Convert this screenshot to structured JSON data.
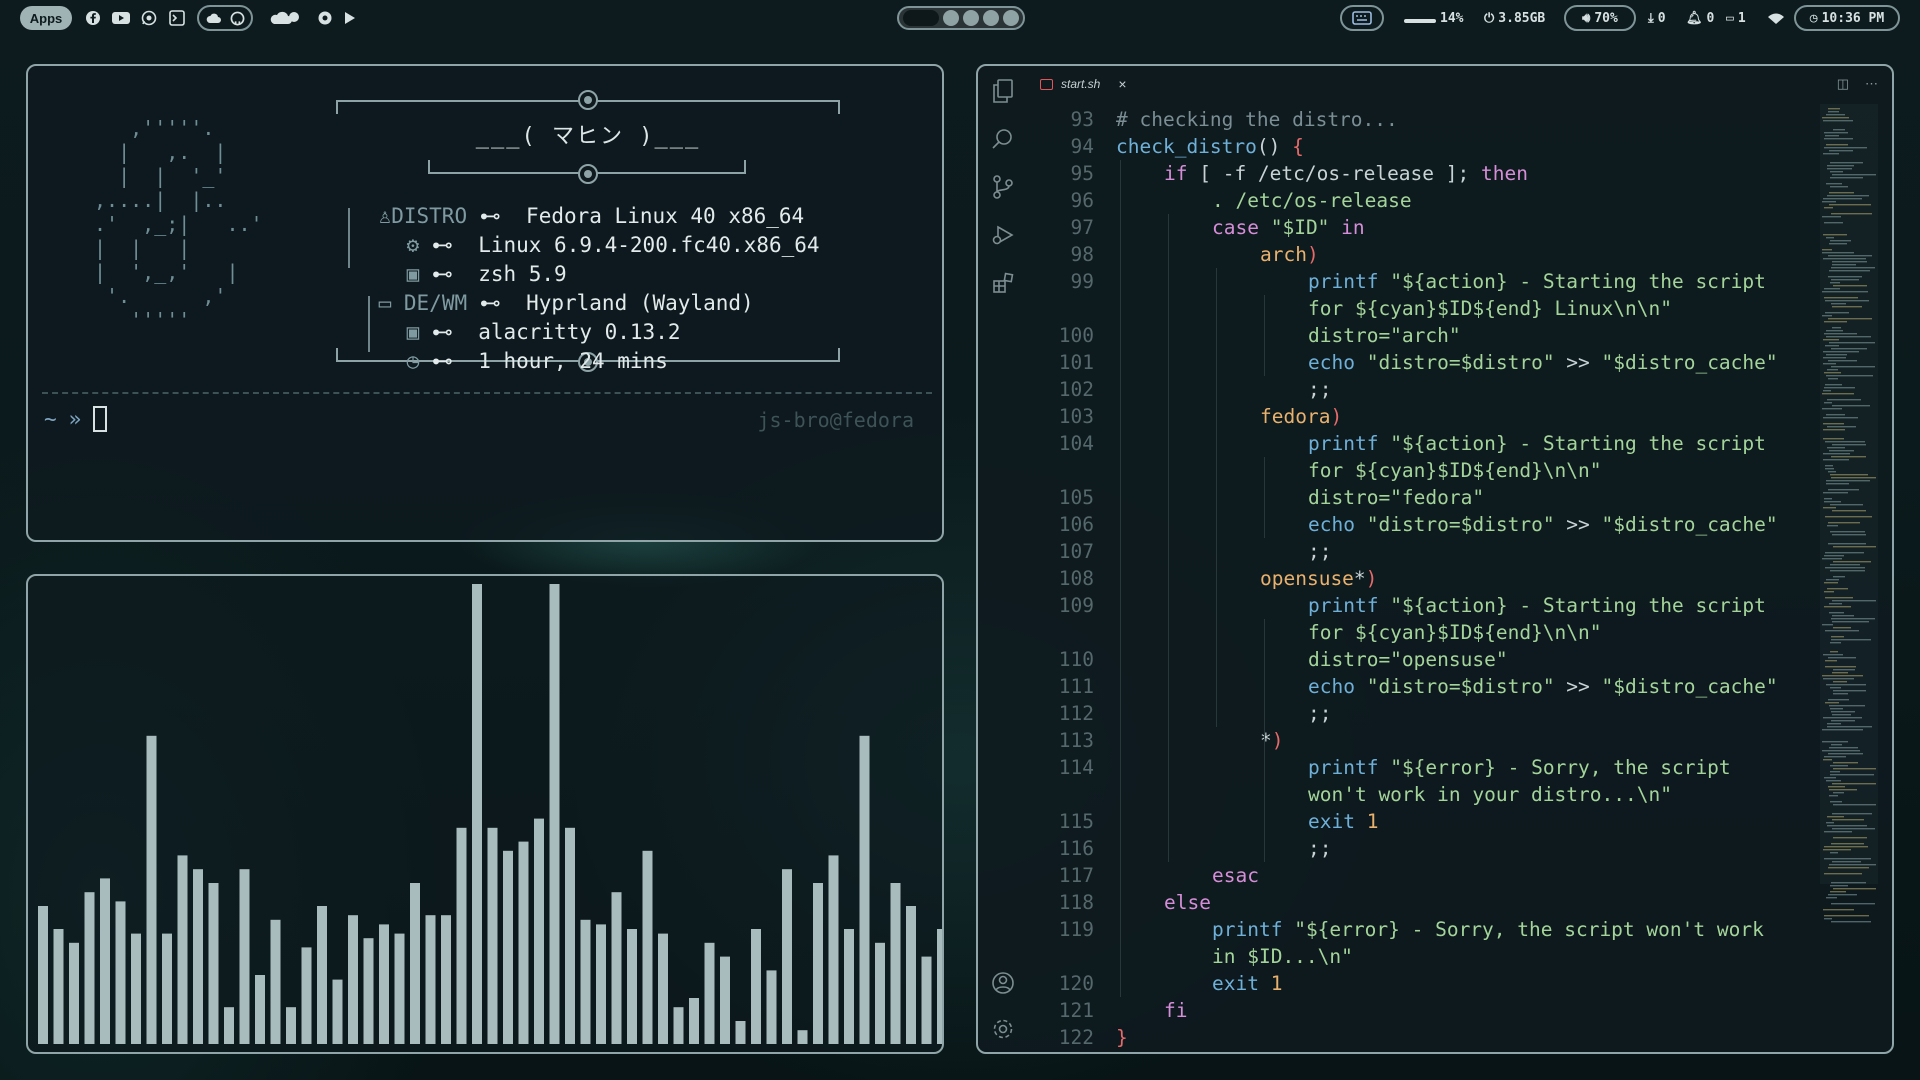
{
  "topbar": {
    "apps_label": "Apps",
    "left_icons": [
      "facebook-icon",
      "youtube-icon",
      "whatsapp-icon",
      "terminal-app-icon",
      "cloud-icon",
      "github-icon",
      "weather-icon",
      "browser-icon",
      "play-icon"
    ],
    "stats": {
      "keyboard": "",
      "cpu": "14%",
      "memory": "3.85GB",
      "volume": "70%",
      "downloads": "0",
      "notifications": "0",
      "clipboard": "1",
      "time": "10:36 PM"
    }
  },
  "terminal": {
    "ascii_art": "   ,'''''.\n  |   ,.  |\n  |  |  '_'\n,....|  |..\n.'  ,_;|   ..'\n|  |   |\n|  ',_,'   |\n '.      ,'\n   '''''",
    "title": "___( マヒン )___",
    "rows": [
      {
        "key": "DISTRO",
        "value": "Fedora Linux 40 x86_64"
      },
      {
        "key": "",
        "value": "Linux 6.9.4-200.fc40.x86_64"
      },
      {
        "key": "",
        "value": "zsh 5.9"
      },
      {
        "key": "DE/WM",
        "value": "Hyprland (Wayland)"
      },
      {
        "key": "",
        "value": "alacritty 0.13.2"
      },
      {
        "key": "",
        "value": "1 hour, 24 mins"
      }
    ],
    "arrow": "⊷",
    "prompt_tilde": "~",
    "prompt_arrow": "»",
    "host": "js-bro@fedora"
  },
  "visualizer": {
    "levels": [
      0.3,
      0.25,
      0.22,
      0.33,
      0.36,
      0.31,
      0.24,
      0.67,
      0.24,
      0.41,
      0.38,
      0.35,
      0.08,
      0.38,
      0.15,
      0.27,
      0.08,
      0.21,
      0.3,
      0.14,
      0.28,
      0.23,
      0.26,
      0.24,
      0.35,
      0.28,
      0.28,
      0.47,
      1.0,
      0.47,
      0.42,
      0.44,
      0.49,
      1.0,
      0.47,
      0.27,
      0.26,
      0.33,
      0.25,
      0.42,
      0.24,
      0.08,
      0.1,
      0.22,
      0.19,
      0.05,
      0.25,
      0.16,
      0.38,
      0.03,
      0.35,
      0.41,
      0.25,
      0.67,
      0.22,
      0.35,
      0.3,
      0.19,
      0.25,
      0.26
    ]
  },
  "editor": {
    "tab_name": "start.sh",
    "tab_close": "×",
    "lines": [
      {
        "n": "93",
        "indent": 0,
        "html": [
          [
            "cm",
            "# checking the distro..."
          ]
        ]
      },
      {
        "n": "94",
        "indent": 0,
        "html": [
          [
            "fn",
            "check_distro"
          ],
          [
            "op",
            "() "
          ],
          [
            "pa",
            "{"
          ]
        ]
      },
      {
        "n": "95",
        "indent": 1,
        "html": [
          [
            "kw",
            "if"
          ],
          [
            "op",
            " [ -f /etc/os-release ]; "
          ],
          [
            "kw",
            "then"
          ]
        ]
      },
      {
        "n": "96",
        "indent": 2,
        "html": [
          [
            "st",
            ". /etc/os-release"
          ]
        ]
      },
      {
        "n": "97",
        "indent": 2,
        "html": [
          [
            "kw",
            "case"
          ],
          [
            "op",
            " "
          ],
          [
            "st",
            "\"$ID\""
          ],
          [
            "op",
            " "
          ],
          [
            "kw",
            "in"
          ]
        ]
      },
      {
        "n": "98",
        "indent": 3,
        "html": [
          [
            "nu",
            "arch"
          ],
          [
            "pa",
            ")"
          ]
        ]
      },
      {
        "n": "99",
        "indent": 4,
        "html": [
          [
            "fn",
            "printf"
          ],
          [
            "op",
            " "
          ],
          [
            "st",
            "\"${action} - Starting the script"
          ]
        ]
      },
      {
        "n": "",
        "indent": 4,
        "html": [
          [
            "st",
            "for ${cyan}$ID${end} Linux\\n\\n\""
          ]
        ]
      },
      {
        "n": "100",
        "indent": 4,
        "html": [
          [
            "st",
            "distro=\"arch\""
          ]
        ]
      },
      {
        "n": "101",
        "indent": 4,
        "html": [
          [
            "fn",
            "echo"
          ],
          [
            "op",
            " "
          ],
          [
            "st",
            "\"distro=$distro\""
          ],
          [
            "op",
            " >> "
          ],
          [
            "st",
            "\"$distro_cache\""
          ]
        ]
      },
      {
        "n": "102",
        "indent": 4,
        "html": [
          [
            "op",
            ";;"
          ]
        ]
      },
      {
        "n": "103",
        "indent": 3,
        "html": [
          [
            "nu",
            "fedora"
          ],
          [
            "pa",
            ")"
          ]
        ]
      },
      {
        "n": "104",
        "indent": 4,
        "html": [
          [
            "fn",
            "printf"
          ],
          [
            "op",
            " "
          ],
          [
            "st",
            "\"${action} - Starting the script"
          ]
        ]
      },
      {
        "n": "",
        "indent": 4,
        "html": [
          [
            "st",
            "for ${cyan}$ID${end}\\n\\n\""
          ]
        ]
      },
      {
        "n": "105",
        "indent": 4,
        "html": [
          [
            "st",
            "distro=\"fedora\""
          ]
        ]
      },
      {
        "n": "106",
        "indent": 4,
        "html": [
          [
            "fn",
            "echo"
          ],
          [
            "op",
            " "
          ],
          [
            "st",
            "\"distro=$distro\""
          ],
          [
            "op",
            " >> "
          ],
          [
            "st",
            "\"$distro_cache\""
          ]
        ]
      },
      {
        "n": "107",
        "indent": 4,
        "html": [
          [
            "op",
            ";;"
          ]
        ]
      },
      {
        "n": "108",
        "indent": 3,
        "html": [
          [
            "nu",
            "opensuse"
          ],
          [
            "op",
            "*"
          ],
          [
            "pa",
            ")"
          ]
        ]
      },
      {
        "n": "109",
        "indent": 4,
        "html": [
          [
            "fn",
            "printf"
          ],
          [
            "op",
            " "
          ],
          [
            "st",
            "\"${action} - Starting the script"
          ]
        ]
      },
      {
        "n": "",
        "indent": 4,
        "html": [
          [
            "st",
            "for ${cyan}$ID${end}\\n\\n\""
          ]
        ]
      },
      {
        "n": "110",
        "indent": 4,
        "html": [
          [
            "st",
            "distro=\"opensuse\""
          ]
        ]
      },
      {
        "n": "111",
        "indent": 4,
        "html": [
          [
            "fn",
            "echo"
          ],
          [
            "op",
            " "
          ],
          [
            "st",
            "\"distro=$distro\""
          ],
          [
            "op",
            " >> "
          ],
          [
            "st",
            "\"$distro_cache\""
          ]
        ]
      },
      {
        "n": "112",
        "indent": 4,
        "html": [
          [
            "op",
            ";;"
          ]
        ]
      },
      {
        "n": "113",
        "indent": 3,
        "html": [
          [
            "op",
            "*"
          ],
          [
            "pa",
            ")"
          ]
        ]
      },
      {
        "n": "114",
        "indent": 4,
        "html": [
          [
            "fn",
            "printf"
          ],
          [
            "op",
            " "
          ],
          [
            "st",
            "\"${error} - Sorry, the script"
          ]
        ]
      },
      {
        "n": "",
        "indent": 4,
        "html": [
          [
            "st",
            "won't work in your distro...\\n\""
          ]
        ]
      },
      {
        "n": "115",
        "indent": 4,
        "html": [
          [
            "fn",
            "exit"
          ],
          [
            "op",
            " "
          ],
          [
            "nu",
            "1"
          ]
        ]
      },
      {
        "n": "116",
        "indent": 4,
        "html": [
          [
            "op",
            ";;"
          ]
        ]
      },
      {
        "n": "117",
        "indent": 2,
        "html": [
          [
            "kw",
            "esac"
          ]
        ]
      },
      {
        "n": "118",
        "indent": 1,
        "html": [
          [
            "kw",
            "else"
          ]
        ]
      },
      {
        "n": "119",
        "indent": 2,
        "html": [
          [
            "fn",
            "printf"
          ],
          [
            "op",
            " "
          ],
          [
            "st",
            "\"${error} - Sorry, the script won't work"
          ]
        ]
      },
      {
        "n": "",
        "indent": 2,
        "html": [
          [
            "st",
            "in $ID...\\n\""
          ]
        ]
      },
      {
        "n": "120",
        "indent": 2,
        "html": [
          [
            "fn",
            "exit"
          ],
          [
            "op",
            " "
          ],
          [
            "nu",
            "1"
          ]
        ]
      },
      {
        "n": "121",
        "indent": 1,
        "html": [
          [
            "kw",
            "fi"
          ]
        ]
      },
      {
        "n": "122",
        "indent": 0,
        "html": [
          [
            "pa",
            "}"
          ]
        ]
      }
    ]
  }
}
